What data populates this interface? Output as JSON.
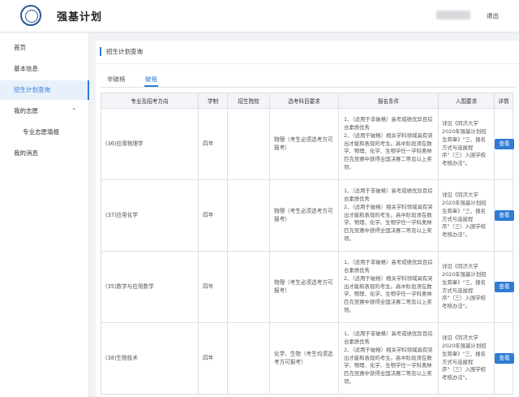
{
  "header": {
    "title": "强基计划",
    "logout_label": "退出"
  },
  "sidebar": {
    "items": [
      {
        "label": "首页"
      },
      {
        "label": "基本信息"
      },
      {
        "label": "招生计划查询"
      },
      {
        "label": "我的志愿"
      },
      {
        "label": "专业志愿填报"
      },
      {
        "label": "我的消息"
      }
    ]
  },
  "main": {
    "breadcrumb": "招生计划查询",
    "tabs": [
      {
        "label": "非破格"
      },
      {
        "label": "破格"
      }
    ],
    "table": {
      "headers": [
        "专业及招考方向",
        "学制",
        "招生院校",
        "选考科目要求",
        "报名条件",
        "入围要求",
        "详情"
      ],
      "rows": [
        {
          "major": "(36)应用物理学",
          "years": "四年",
          "school": "",
          "subjects": "物理（考生必须选考方可报考）",
          "conditions": "1、（适用于非破格）高考成绩优异且综合素质优秀\n2、（适用于破格）相关学科领域具有突出才能和表现的考生。高中阶段须在数学、物理、化学、生物学任一学科奥林匹克竞赛中获得全国决赛二等及以上奖项。",
          "admission": "详见《同济大学2020年强基计划招生简章》\"三、报名方式与选拔程序\"（三）入围学校考核办法\"。",
          "button": "查看"
        },
        {
          "major": "(37)应用化学",
          "years": "四年",
          "school": "",
          "subjects": "物理（考生必须选考方可报考）",
          "conditions": "1、（适用于非破格）高考成绩优异且综合素质优秀\n2、（适用于破格）相关学科领域具有突出才能和表现的考生。高中阶段须在数学、物理、化学、生物学任一学科奥林匹克竞赛中获得全国决赛二等及以上奖项。",
          "admission": "详见《同济大学2020年强基计划招生简章》\"三、报名方式与选拔程序\"（三）入围学校考核办法\"。",
          "button": "查看"
        },
        {
          "major": "(35)数学与应用数学",
          "years": "四年",
          "school": "",
          "subjects": "物理（考生必须选考方可报考）",
          "conditions": "1、（适用于非破格）高考成绩优异且综合素质优秀\n2、（适用于破格）相关学科领域具有突出才能和表现的考生。高中阶段须在数学、物理、化学、生物学任一学科奥林匹克竞赛中获得全国决赛二等及以上奖项。",
          "admission": "详见《同济大学2020年强基计划招生简章》\"三、报名方式与选拔程序\"（三）入围学校考核办法\"。",
          "button": "查看"
        },
        {
          "major": "(38)生物技术",
          "years": "四年",
          "school": "",
          "subjects": "化学、生物（考生均须选考方可报考）",
          "conditions": "1、（适用于非破格）高考成绩优异且综合素质优秀\n2、（适用于破格）相关学科领域具有突出才能和表现的考生。高中阶段须在数学、物理、化学、生物学任一学科奥林匹克竞赛中获得全国决赛二等及以上奖项。",
          "admission": "详见《同济大学2020年强基计划招生简章》\"三、报名方式与选拔程序\"（三）入围学校考核办法\"。",
          "button": "查看"
        }
      ]
    }
  }
}
